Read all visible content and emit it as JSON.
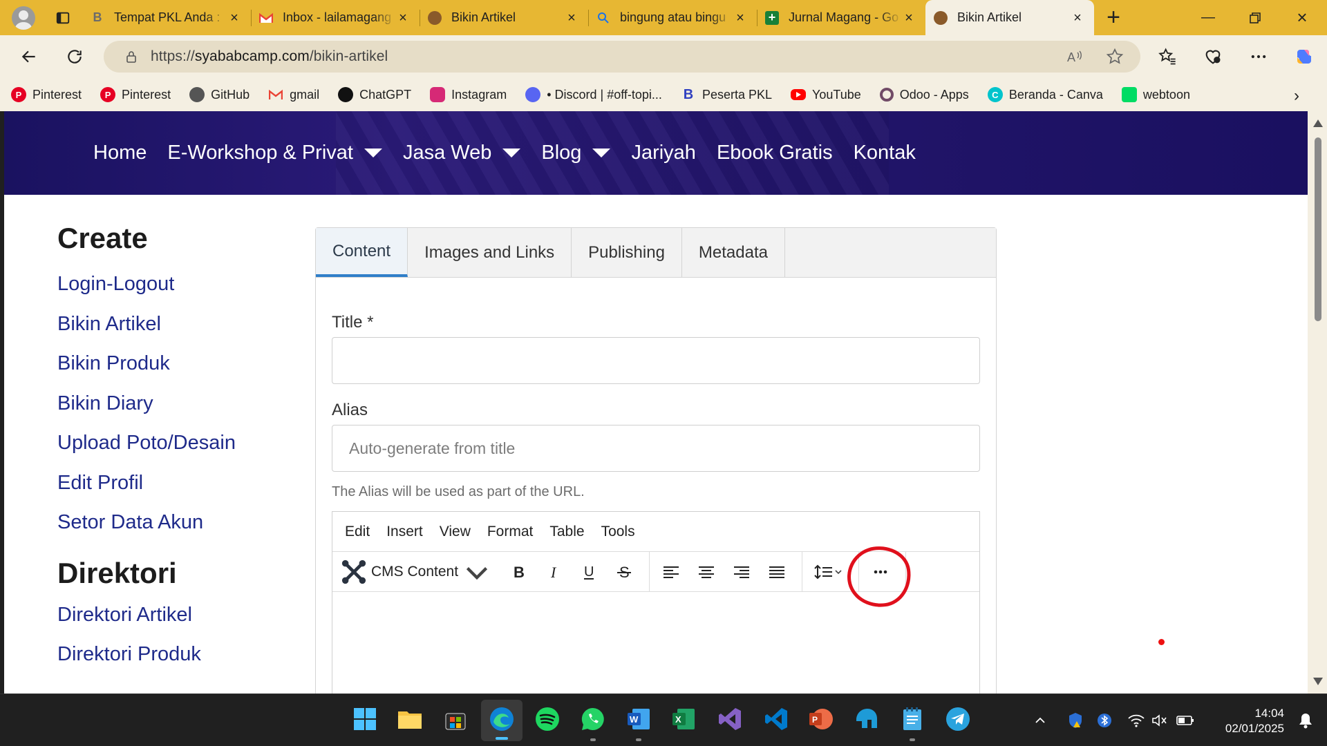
{
  "browser": {
    "tabs": [
      {
        "title": "Tempat PKL Anda :",
        "favicon": "b-icon",
        "color": "#5b5b5b"
      },
      {
        "title": "Inbox - lailamagang",
        "favicon": "gmail-icon",
        "color": "#ea4335"
      },
      {
        "title": "Bikin Artikel",
        "favicon": "syababcamp-icon",
        "color": "#8a5a2a"
      },
      {
        "title": "bingung atau bingu",
        "favicon": "search-icon",
        "color": "#1a73e8"
      },
      {
        "title": "Jurnal Magang - Go",
        "favicon": "sheets-icon",
        "color": "#188038"
      },
      {
        "title": "Bikin Artikel",
        "favicon": "syababcamp-icon",
        "color": "#8a5a2a"
      }
    ],
    "active_tab_index": 5,
    "url_prefix": "https://",
    "url_host": "syababcamp.com",
    "url_path": "/bikin-artikel",
    "bookmarks": [
      {
        "label": "Pinterest",
        "icon": "pinterest-icon",
        "color": "#e60023"
      },
      {
        "label": "Pinterest",
        "icon": "pinterest-icon",
        "color": "#e60023"
      },
      {
        "label": "GitHub",
        "icon": "github-icon",
        "color": "#555555"
      },
      {
        "label": "gmail",
        "icon": "gmail-icon",
        "color": "#ea4335"
      },
      {
        "label": "ChatGPT",
        "icon": "chatgpt-icon",
        "color": "#111111"
      },
      {
        "label": "Instagram",
        "icon": "instagram-icon",
        "color": "#d62976"
      },
      {
        "label": "• Discord | #off-topi...",
        "icon": "discord-icon",
        "color": "#5865f2"
      },
      {
        "label": "Peserta PKL",
        "icon": "b-icon",
        "color": "#3040c0"
      },
      {
        "label": "YouTube",
        "icon": "youtube-icon",
        "color": "#ff0000"
      },
      {
        "label": "Odoo - Apps",
        "icon": "odoo-icon",
        "color": "#714b67"
      },
      {
        "label": "Beranda - Canva",
        "icon": "canva-icon",
        "color": "#00c4cc"
      },
      {
        "label": "webtoon",
        "icon": "webtoon-icon",
        "color": "#00dc64"
      }
    ]
  },
  "site": {
    "nav": [
      {
        "label": "Home",
        "dropdown": false
      },
      {
        "label": "E-Workshop & Privat",
        "dropdown": true
      },
      {
        "label": "Jasa Web",
        "dropdown": true
      },
      {
        "label": "Blog",
        "dropdown": true
      },
      {
        "label": "Jariyah",
        "dropdown": false
      },
      {
        "label": "Ebook Gratis",
        "dropdown": false
      },
      {
        "label": "Kontak",
        "dropdown": false
      }
    ],
    "sidebar": {
      "create_title": "Create",
      "create_links": [
        "Login-Logout",
        "Bikin Artikel",
        "Bikin Produk",
        "Bikin Diary",
        "Upload Poto/Desain",
        "Edit Profil",
        "Setor Data Akun"
      ],
      "directory_title": "Direktori",
      "directory_links": [
        "Direktori Artikel",
        "Direktori Produk"
      ]
    }
  },
  "editor": {
    "tabs": [
      "Content",
      "Images and Links",
      "Publishing",
      "Metadata"
    ],
    "active_tab": "Content",
    "title_label": "Title *",
    "title_value": "",
    "alias_label": "Alias",
    "alias_placeholder": "Auto-generate from title",
    "alias_help": "The Alias will be used as part of the URL.",
    "menubar": [
      "Edit",
      "Insert",
      "View",
      "Format",
      "Table",
      "Tools"
    ],
    "cms_content_label": "CMS Content",
    "toolbar_buttons": [
      "bold-icon",
      "italic-icon",
      "underline-icon",
      "strikethrough-icon",
      "align-left-icon",
      "align-center-icon",
      "align-right-icon",
      "align-justify-icon",
      "line-height-icon",
      "more-icon"
    ],
    "annotation_color": "#e0101c"
  },
  "taskbar": {
    "apps": [
      "windows-start-icon",
      "file-explorer-icon",
      "microsoft-store-icon",
      "edge-icon",
      "spotify-icon",
      "whatsapp-icon",
      "word-icon",
      "excel-icon",
      "visual-studio-icon",
      "vscode-icon",
      "powerpoint-icon",
      "app-icon",
      "notepad-icon",
      "telegram-icon"
    ],
    "time": "14:04",
    "date": "02/01/2025"
  }
}
